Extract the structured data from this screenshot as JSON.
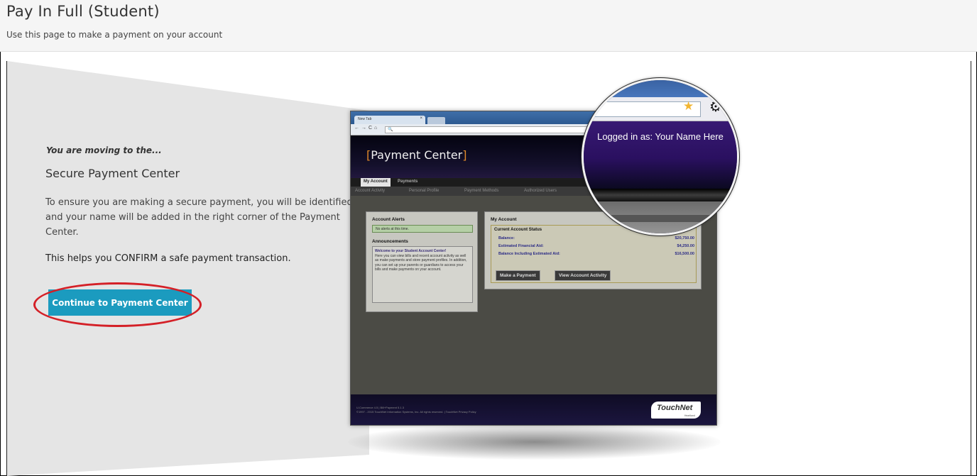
{
  "header": {
    "title": "Pay In Full (Student)",
    "subtitle": "Use this page to make a payment on your account"
  },
  "intro": {
    "moving_text": "You are moving to the...",
    "heading": "Secure Payment Center",
    "description": "To ensure you are making a secure payment, you will be identified and your name will be added in the right corner of the Payment Center.",
    "confirm_text": "This helps you CONFIRM a safe payment transaction.",
    "continue_button": "Continue to Payment Center"
  },
  "colors": {
    "button": "#1b9bbf",
    "highlight_ring": "#d42027",
    "banner_purple": "#2a1060",
    "brand_orange": "#e0892a"
  },
  "preview": {
    "browser_tab": "New Tab",
    "title_bracket_left": "[",
    "title_text": "Payment Center",
    "title_bracket_right": "]",
    "tabs": [
      "My Account",
      "Payments"
    ],
    "subnav": [
      "Account Activity",
      "Personal Profile",
      "Payment Methods",
      "Authorized Users"
    ],
    "alerts_heading": "Account Alerts",
    "alerts_text": "No alerts at this time.",
    "announcements_heading": "Announcements",
    "announcement_title": "Welcome to your Student Account Center!",
    "announcement_body": "Here you can view bills and recent account activity as well as make payments and store payment profiles. In addition, you can set up your parents or guardians to access your bills and make payments on your account.",
    "my_account_heading": "My Account",
    "status_heading": "Current Account Status",
    "balance_rows": [
      {
        "label": "Balance:",
        "amount": "$20,750.00"
      },
      {
        "label": "Estimated Financial Aid:",
        "amount": "$4,250.00"
      },
      {
        "label": "Balance Including Estimated Aid:",
        "amount": "$16,500.00"
      }
    ],
    "make_payment_button": "Make a Payment",
    "view_activity_button": "View Account Activity",
    "footer_line1": "U.Commerce 4.5 | Bill+Payment 5.1.3",
    "footer_line2": "©1997 - 2015 TouchNet Information Systems, Inc. All rights reserved. | TouchNet Privacy Policy",
    "logo_text": "TouchNet",
    "logo_sub": "Heartland",
    "magnified_label": "Logged in as: Your Name Here"
  },
  "icons": {
    "star": "star-icon",
    "gear": "gear-icon"
  }
}
